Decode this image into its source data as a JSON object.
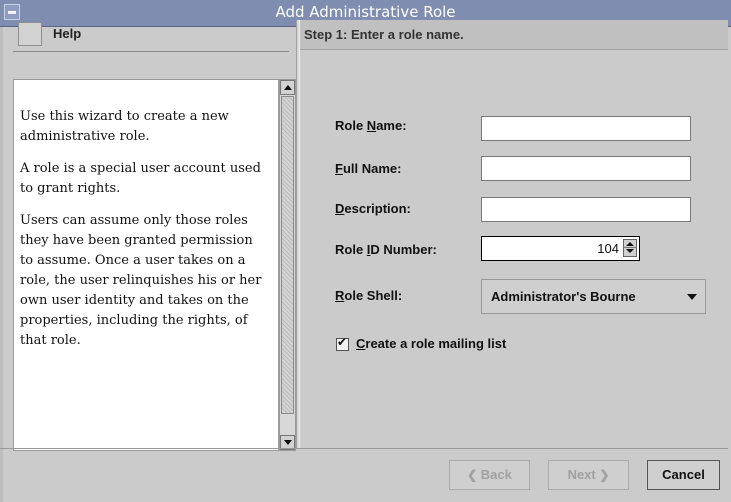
{
  "window": {
    "title": "Add Administrative Role"
  },
  "help": {
    "title": "Help",
    "paragraphs": [
      "Use this wizard to create a new administrative role.",
      "A role is a special user account used to grant rights.",
      "Users can assume only those roles they have been granted permission to assume. Once a user takes on a role, the user relinquishes his or her own user identity and takes on the properties, including the rights, of that role."
    ]
  },
  "step": {
    "title": "Step 1: Enter a role name."
  },
  "form": {
    "role_name": {
      "mnemonic_prefix": "Role ",
      "mnemonic": "N",
      "suffix": "ame:",
      "value": ""
    },
    "full_name": {
      "mnemonic_prefix": "",
      "mnemonic": "F",
      "suffix": "ull Name:",
      "value": ""
    },
    "description": {
      "mnemonic_prefix": "",
      "mnemonic": "D",
      "suffix": "escription:",
      "value": ""
    },
    "role_id": {
      "mnemonic_prefix": "Role ",
      "mnemonic": "I",
      "suffix": "D Number:",
      "value": "104"
    },
    "role_shell": {
      "mnemonic_prefix": "",
      "mnemonic": "R",
      "suffix": "ole Shell:",
      "value": "Administrator's Bourne"
    },
    "mailing_list": {
      "mnemonic": "C",
      "suffix": "reate a role mailing list",
      "checked": true,
      "check_glyph": "✔"
    }
  },
  "buttons": {
    "back": {
      "label": "Back",
      "icon": "chevron-left-icon",
      "glyph": "❮",
      "enabled": false
    },
    "next": {
      "label": "Next",
      "icon": "chevron-right-icon",
      "glyph": "❯",
      "enabled": false
    },
    "cancel": {
      "label": "Cancel",
      "enabled": true
    }
  },
  "colors": {
    "titlebar": "#7e8db0",
    "panel": "#cbcbcb",
    "field": "#ffffff",
    "disabled_text": "#a0a0a0"
  }
}
